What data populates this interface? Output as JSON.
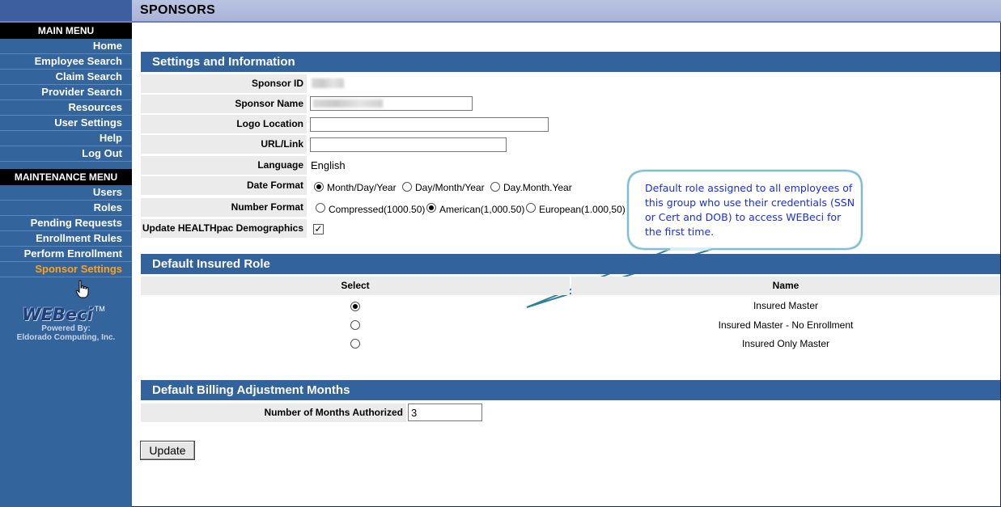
{
  "page": {
    "title": "SPONSORS"
  },
  "sidebar": {
    "main_menu_title": "MAIN MENU",
    "main_items": [
      {
        "label": "Home"
      },
      {
        "label": "Employee Search"
      },
      {
        "label": "Claim Search"
      },
      {
        "label": "Provider Search"
      },
      {
        "label": "Resources"
      },
      {
        "label": "User Settings"
      },
      {
        "label": "Help"
      },
      {
        "label": "Log Out"
      }
    ],
    "maintenance_menu_title": "MAINTENANCE MENU",
    "maintenance_items": [
      {
        "label": "Users"
      },
      {
        "label": "Roles"
      },
      {
        "label": "Pending Requests"
      },
      {
        "label": "Enrollment Rules"
      },
      {
        "label": "Perform Enrollment"
      },
      {
        "label": "Sponsor Settings",
        "active": true
      }
    ],
    "logo": {
      "name": "WEBeci",
      "tm": "TM",
      "powered_by": "Powered By:",
      "company": "Eldorado Computing, Inc."
    }
  },
  "settings": {
    "section_title": "Settings and Information",
    "sponsor_id_label": "Sponsor ID",
    "sponsor_name_label": "Sponsor Name",
    "logo_location_label": "Logo Location",
    "logo_location_value": "",
    "url_label": "URL/Link",
    "url_value": "",
    "language_label": "Language",
    "language_value": "English",
    "date_format_label": "Date Format",
    "date_format_options": [
      "Month/Day/Year",
      "Day/Month/Year",
      "Day.Month.Year"
    ],
    "date_format_selected": "Month/Day/Year",
    "number_format_label": "Number Format",
    "number_format_options": [
      "Compressed(1000.50)",
      "American(1,000.50)",
      "European(1.000,50)"
    ],
    "number_format_selected": "American(1,000.50)",
    "update_demographics_label": "Update HEALTHpac Demographics",
    "update_demographics_checked": true
  },
  "callout": {
    "text": "Default role assigned to all employees of this group who use their credentials (SSN or Cert and DOB) to access WEBeci for the first time."
  },
  "insured_role": {
    "section_title": "Default Insured Role",
    "col_select": "Select",
    "col_name": "Name",
    "roles": [
      {
        "name": "Insured Master",
        "selected": true
      },
      {
        "name": "Insured Master - No Enrollment",
        "selected": false
      },
      {
        "name": "Insured Only Master",
        "selected": false
      }
    ]
  },
  "billing": {
    "section_title": "Default Billing Adjustment Months",
    "months_label": "Number of Months Authorized",
    "months_value": "3"
  },
  "actions": {
    "update_label": "Update"
  },
  "colors": {
    "sidebar": "#34649c",
    "header_bar": "#33639d",
    "active_menu": "#ffa21a",
    "callout_text": "#1c2fd6"
  }
}
